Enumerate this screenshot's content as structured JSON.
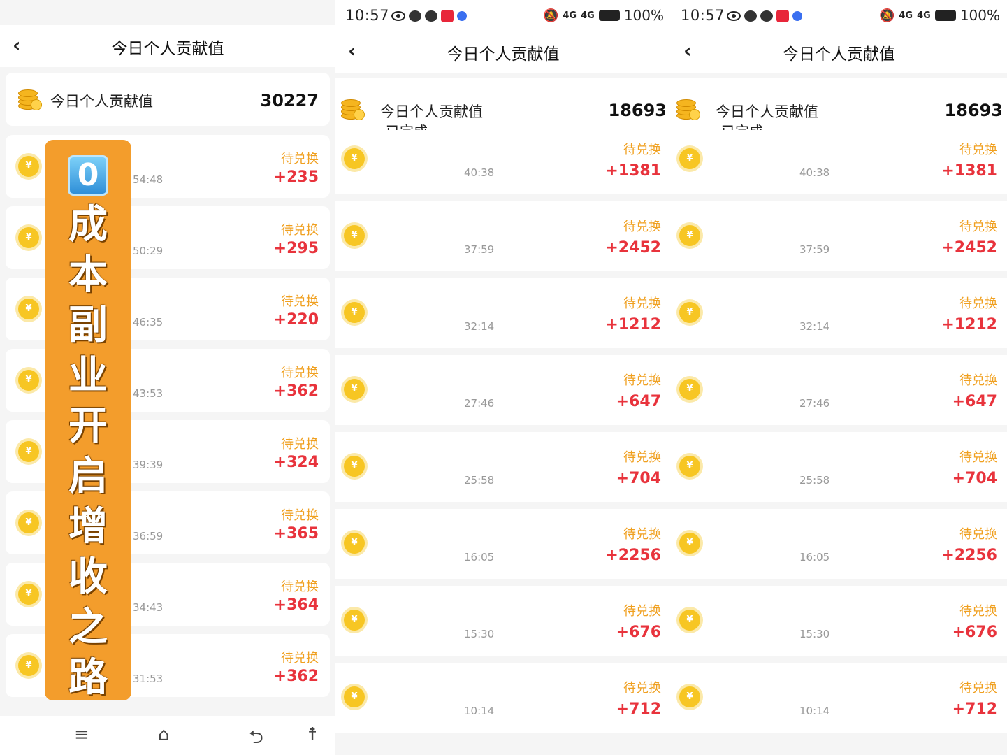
{
  "status": {
    "time": "10:57",
    "battery": "100%",
    "signal": "4G"
  },
  "header": {
    "title": "今日个人贡献值",
    "back": "‹"
  },
  "panel1": {
    "summary": {
      "label": "今日个人贡献值",
      "value": "30227"
    },
    "rows": [
      {
        "time": "54:48",
        "status": "待兑换",
        "amount": "+235"
      },
      {
        "time": "50:29",
        "status": "待兑换",
        "amount": "+295"
      },
      {
        "time": "46:35",
        "status": "待兑换",
        "amount": "+220"
      },
      {
        "time": "43:53",
        "status": "待兑换",
        "amount": "+362"
      },
      {
        "time": "39:39",
        "status": "待兑换",
        "amount": "+324"
      },
      {
        "time": "36:59",
        "status": "待兑换",
        "amount": "+365"
      },
      {
        "time": "34:43",
        "status": "待兑换",
        "amount": "+364"
      },
      {
        "time": "31:53",
        "status": "待兑换",
        "amount": "+362"
      }
    ]
  },
  "panel2": {
    "summary": {
      "label": "今日个人贡献值",
      "value": "18693"
    },
    "completed": "已完成",
    "rows": [
      {
        "time": "40:38",
        "status": "待兑换",
        "amount": "+1381"
      },
      {
        "time": "37:59",
        "status": "待兑换",
        "amount": "+2452"
      },
      {
        "time": "32:14",
        "status": "待兑换",
        "amount": "+1212"
      },
      {
        "time": "27:46",
        "status": "待兑换",
        "amount": "+647"
      },
      {
        "time": "25:58",
        "status": "待兑换",
        "amount": "+704"
      },
      {
        "time": "16:05",
        "status": "待兑换",
        "amount": "+2256"
      },
      {
        "time": "15:30",
        "status": "待兑换",
        "amount": "+676"
      },
      {
        "time": "10:14",
        "status": "待兑换",
        "amount": "+712"
      }
    ]
  },
  "panel3": {
    "summary": {
      "label": "今日个人贡献值",
      "value": "18693"
    },
    "completed": "已完成",
    "rows": [
      {
        "time": "40:38",
        "status": "待兑换",
        "amount": "+1381"
      },
      {
        "time": "37:59",
        "status": "待兑换",
        "amount": "+2452"
      },
      {
        "time": "32:14",
        "status": "待兑换",
        "amount": "+1212"
      },
      {
        "time": "27:46",
        "status": "待兑换",
        "amount": "+647"
      },
      {
        "time": "25:58",
        "status": "待兑换",
        "amount": "+704"
      },
      {
        "time": "16:05",
        "status": "待兑换",
        "amount": "+2256"
      },
      {
        "time": "15:30",
        "status": "待兑换",
        "amount": "+676"
      },
      {
        "time": "10:14",
        "status": "待兑换",
        "amount": "+712"
      }
    ]
  },
  "banner": {
    "zero": "0",
    "text": "成本副业开启增收之路"
  },
  "coin_symbol": "¥",
  "bottom_nav": {
    "menu": "≡",
    "home": "⌂",
    "back": "⮌",
    "accessibility": "☨"
  },
  "colors": {
    "amount": "#e8333c",
    "status": "#f0a020",
    "banner": "#f39d2c",
    "coin": "#f7c623"
  }
}
